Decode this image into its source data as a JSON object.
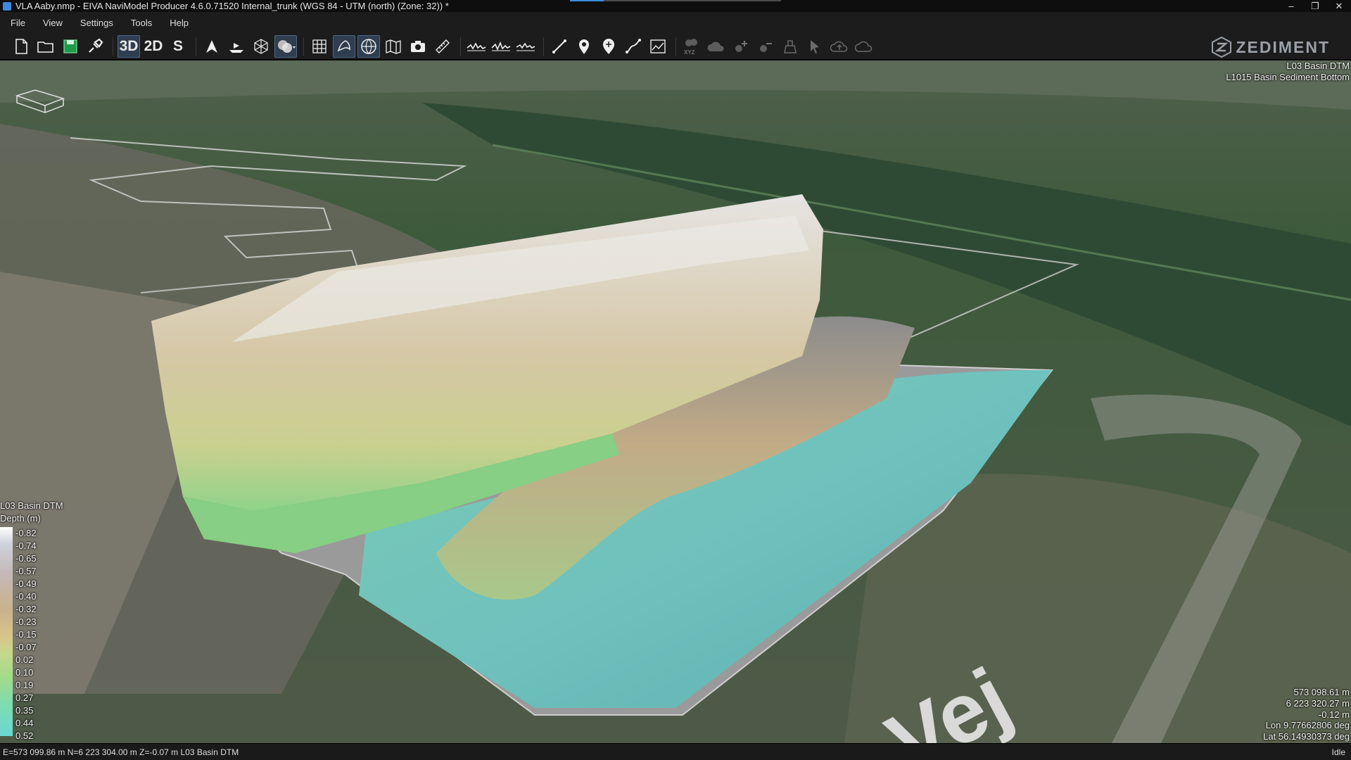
{
  "window": {
    "title": "VLA Aaby.nmp - EIVA NaviModel Producer 4.6.0.71520 Internal_trunk (WGS 84 - UTM (north) (Zone: 32)) *",
    "progress": 0.16
  },
  "window_controls": {
    "minimize": "–",
    "restore": "❐",
    "close": "✕"
  },
  "menu": [
    "File",
    "View",
    "Settings",
    "Tools",
    "Help"
  ],
  "toolbar": {
    "view_3d": "3D",
    "view_2d": "2D",
    "view_s": "S"
  },
  "brand": "ZEDIMENT",
  "layers": {
    "line1": "L03 Basin DTM",
    "line2": "L1015 Basin Sediment Bottom"
  },
  "map_label": "Vej",
  "legend": {
    "title": "L03 Basin DTM",
    "subtitle": "Depth (m)",
    "ticks": [
      "-0.82",
      "-0.74",
      "-0.65",
      "-0.57",
      "-0.49",
      "-0.40",
      "-0.32",
      "-0.23",
      "-0.15",
      "-0.07",
      "0.02",
      "0.10",
      "0.19",
      "0.27",
      "0.35",
      "0.44",
      "0.52"
    ]
  },
  "coords": {
    "easting": "573 098.61 m",
    "northing": "6 223 320.27 m",
    "z": "-0.12 m",
    "lon": "Lon 9.77662806 deg",
    "lat": "Lat 56.14930373 deg"
  },
  "status": {
    "left": "E=573 099.86 m N=6 223 304.00 m Z=-0.07 m L03 Basin DTM",
    "right": "Idle"
  }
}
